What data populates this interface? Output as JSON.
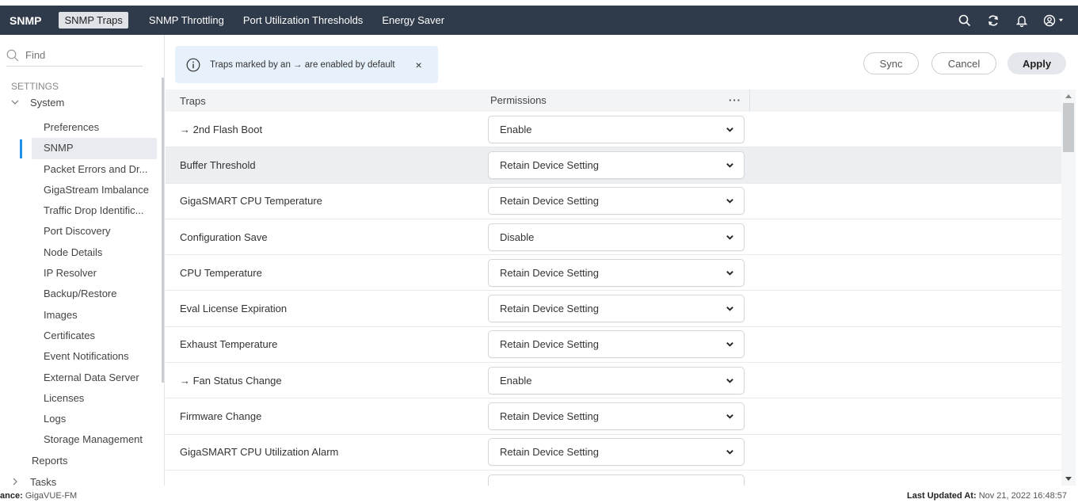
{
  "topbar": {
    "title": "SNMP",
    "tabs": [
      {
        "label": "SNMP Traps",
        "active": true
      },
      {
        "label": "SNMP Throttling",
        "active": false
      },
      {
        "label": "Port Utilization Thresholds",
        "active": false
      },
      {
        "label": "Energy Saver",
        "active": false
      }
    ],
    "icons": [
      "search-icon",
      "refresh-icon",
      "bell-icon",
      "user-icon"
    ],
    "bg_color": "#2f3a4a"
  },
  "sidebar": {
    "search_placeholder": "Find",
    "section_label": "SETTINGS",
    "system_label": "System",
    "items": [
      {
        "label": "Preferences"
      },
      {
        "label": "SNMP",
        "active": true
      },
      {
        "label": "Packet Errors and Dr..."
      },
      {
        "label": "GigaStream Imbalance"
      },
      {
        "label": "Traffic Drop Identific..."
      },
      {
        "label": "Port Discovery"
      },
      {
        "label": "Node Details"
      },
      {
        "label": "IP Resolver"
      },
      {
        "label": "Backup/Restore"
      },
      {
        "label": "Images"
      },
      {
        "label": "Certificates"
      },
      {
        "label": "Event Notifications"
      },
      {
        "label": "External Data Server"
      },
      {
        "label": "Licenses"
      },
      {
        "label": "Logs"
      },
      {
        "label": "Storage Management"
      }
    ],
    "reports_label": "Reports",
    "tasks_label": "Tasks",
    "accent_color": "#1e90e6"
  },
  "toolbar": {
    "info_message": "Traps marked by an → are enabled by default",
    "close_label": "×",
    "sync_label": "Sync",
    "cancel_label": "Cancel",
    "apply_label": "Apply"
  },
  "table": {
    "headers": {
      "traps": "Traps",
      "permissions": "Permissions",
      "more": "···"
    },
    "rows": [
      {
        "trap": "→ 2nd Flash Boot",
        "permission": "Enable"
      },
      {
        "trap": "Buffer Threshold",
        "permission": "Retain Device Setting",
        "highlight": true
      },
      {
        "trap": "GigaSMART CPU Temperature",
        "permission": "Retain Device Setting"
      },
      {
        "trap": "Configuration Save",
        "permission": "Disable"
      },
      {
        "trap": "CPU Temperature",
        "permission": "Retain Device Setting"
      },
      {
        "trap": "Eval License Expiration",
        "permission": "Retain Device Setting"
      },
      {
        "trap": "Exhaust Temperature",
        "permission": "Retain Device Setting"
      },
      {
        "trap": "→ Fan Status Change",
        "permission": "Enable"
      },
      {
        "trap": "Firmware Change",
        "permission": "Retain Device Setting"
      },
      {
        "trap": "GigaSMART CPU Utilization Alarm",
        "permission": "Retain Device Setting"
      },
      {
        "trap": "",
        "permission": ""
      }
    ]
  },
  "footer": {
    "instance_label": "ance:",
    "instance_value": "GigaVUE-FM",
    "updated_label": "Last Updated At:",
    "updated_value": "Nov 21, 2022 16:48:57"
  }
}
